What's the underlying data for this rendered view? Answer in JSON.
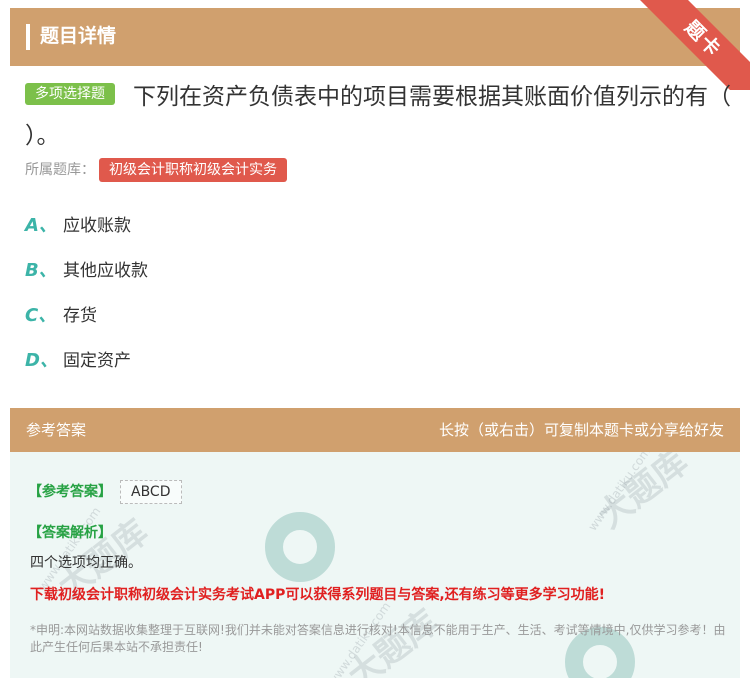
{
  "header": {
    "title": "题目详情",
    "ribbon": "题卡"
  },
  "question": {
    "tag": "多项选择题",
    "text": "下列在资产负债表中的项目需要根据其账面价值列示的有（ ）。",
    "source_label": "所属题库：",
    "source_value": "初级会计职称初级会计实务"
  },
  "options": [
    {
      "letter": "A、",
      "text": "应收账款"
    },
    {
      "letter": "B、",
      "text": "其他应收款"
    },
    {
      "letter": "C、",
      "text": "存货"
    },
    {
      "letter": "D、",
      "text": "固定资产"
    }
  ],
  "answer": {
    "header_left": "参考答案",
    "header_right": "长按（或右击）可复制本题卡或分享给好友",
    "ref_label": "【参考答案】",
    "ref_value": "ABCD",
    "analysis_label": "【答案解析】",
    "analysis": "四个选项均正确。",
    "promo": "下载初级会计职称初级会计实务考试APP可以获得系列题目与答案,还有练习等更多学习功能!",
    "disclaimer": "*申明:本网站数据收集整理于互联网!我们并未能对答案信息进行核对!本信息不能用于生产、生活、考试等情境中,仅供学习参考！由此产生任何后果本站不承担责任!"
  },
  "colors": {
    "header": "#d0a06e",
    "tag_green": "#7cc04a",
    "accent_red": "#e0594c",
    "letter_teal": "#3cb4a8",
    "answer_green": "#27a244"
  },
  "icons": [
    "header-bar-icon"
  ]
}
